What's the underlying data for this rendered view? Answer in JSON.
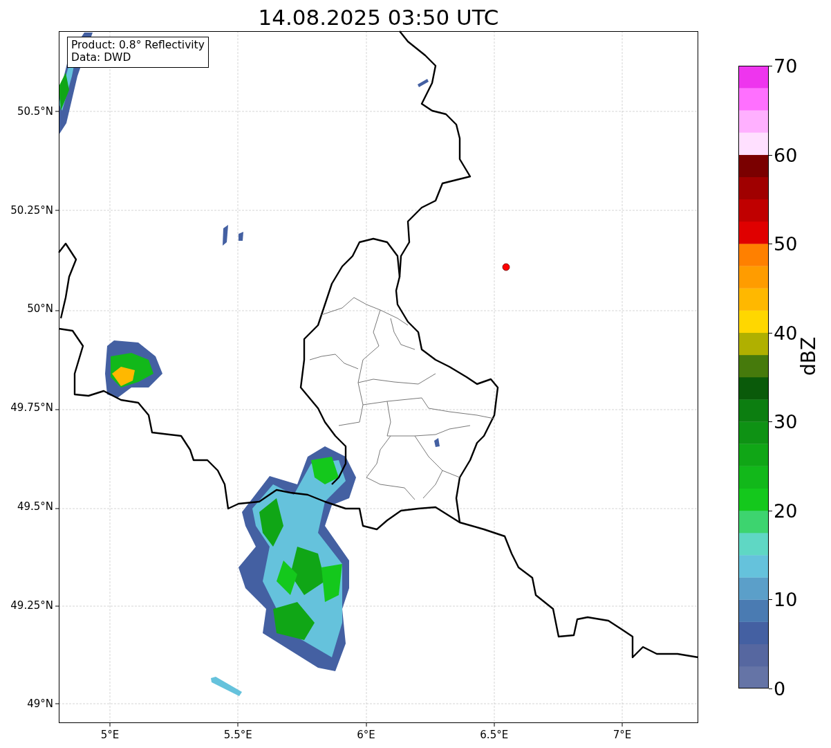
{
  "title": "14.08.2025 03:50 UTC",
  "info_box": {
    "lines": [
      "Product: 0.8° Reflectivity",
      "Data: DWD"
    ]
  },
  "map": {
    "y_labels": [
      "50.5°N",
      "50.25°N",
      "50°N",
      "49.75°N",
      "49.5°N",
      "49.25°N",
      "49°N"
    ],
    "x_labels": [
      "5°E",
      "5.5°E",
      "6°E",
      "6.5°E",
      "7°E"
    ],
    "marker": {
      "color": "#ff0000"
    }
  },
  "colorbar": {
    "label": "dBZ",
    "ticks": [
      "70",
      "60",
      "50",
      "40",
      "30",
      "20",
      "10",
      "0"
    ],
    "bands": [
      {
        "color": "#6574a6"
      },
      {
        "color": "#5667a0"
      },
      {
        "color": "#4460a2"
      },
      {
        "color": "#4a7bb2"
      },
      {
        "color": "#5b9fc9"
      },
      {
        "color": "#65c2dc"
      },
      {
        "color": "#5fd7c4"
      },
      {
        "color": "#3dd46f"
      },
      {
        "color": "#14c81c"
      },
      {
        "color": "#12b81a"
      },
      {
        "color": "#10a616"
      },
      {
        "color": "#0e9214"
      },
      {
        "color": "#0c7e10"
      },
      {
        "color": "#0a5a0a"
      },
      {
        "color": "#467a0c"
      },
      {
        "color": "#b0b000"
      },
      {
        "color": "#ffd700"
      },
      {
        "color": "#ffb800"
      },
      {
        "color": "#ff9c00"
      },
      {
        "color": "#ff8000"
      },
      {
        "color": "#e00000"
      },
      {
        "color": "#c00000"
      },
      {
        "color": "#a00000"
      },
      {
        "color": "#7a0000"
      },
      {
        "color": "#ffe0ff"
      },
      {
        "color": "#ffb0ff"
      },
      {
        "color": "#ff70ff"
      },
      {
        "color": "#ee35ee"
      }
    ]
  }
}
